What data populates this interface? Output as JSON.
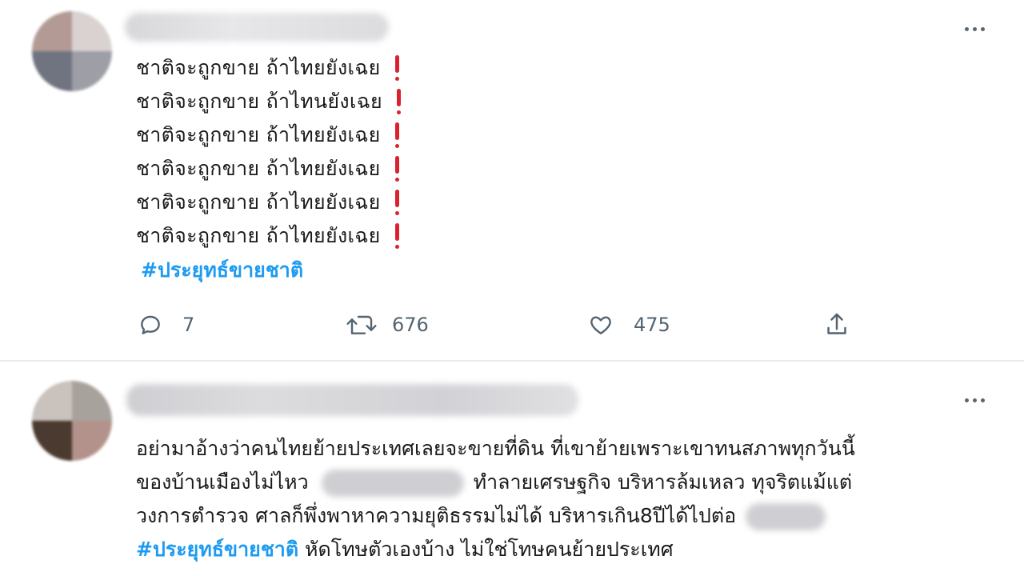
{
  "tweets": [
    {
      "lines": [
        "ชาติจะถูกขาย ถ้าไทยยังเฉย",
        "ชาติจะถูกขาย ถ้าไทนยังเฉย",
        "ชาติจะถูกขาย ถ้าไทยยังเฉย",
        "ชาติจะถูกขาย ถ้าไทยยังเฉย",
        "ชาติจะถูกขาย ถ้าไทยยังเฉย",
        "ชาติจะถูกขาย ถ้าไทยยังเฉย"
      ],
      "hashtag": "#ประยุทธ์ขายชาติ",
      "actions": {
        "reply_count": "7",
        "retweet_count": "676",
        "like_count": "475"
      }
    },
    {
      "line1": "อย่ามาอ้างว่าคนไทยย้ายประเทศเลยจะขายที่ดิน ที่เขาย้ายเพราะเขาทนสภาพทุกวันนี้",
      "line2_a": "ของบ้านเมืองไม่ไหว",
      "line2_b": "ทำลายเศรษฐกิจ บริหารล้มเหลว ทุจริตแม้แต่",
      "line3": "วงการตำรวจ ศาลก็พึ่งพาหาความยุติธรรมไม่ได้ บริหารเกิน8ปีได้ไปต่อ",
      "hashtag": "#ประยุทธ์ขายชาติ",
      "line4_rest": " หัดโทษตัวเองบ้าง ไม่ใช่โทษคนย้ายประเทศ"
    }
  ],
  "icons": {
    "reply": "reply-icon",
    "retweet": "retweet-icon",
    "like": "heart-icon",
    "share": "share-icon",
    "more": "more-icon"
  },
  "colors": {
    "hashtag": "#1d9bf0",
    "exclamation": "#d8232f",
    "action_gray": "#536471",
    "divider": "#e6ecf0"
  }
}
